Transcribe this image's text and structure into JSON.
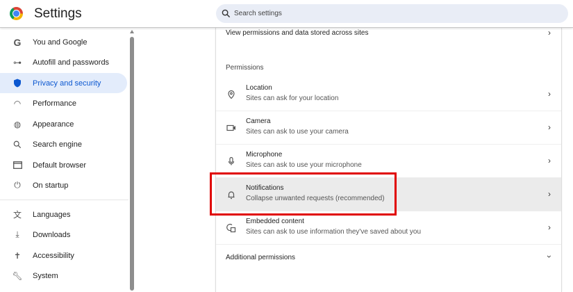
{
  "header": {
    "title": "Settings",
    "search_placeholder": "Search settings"
  },
  "sidebar": {
    "items": [
      {
        "label": "You and Google",
        "icon": "google-icon"
      },
      {
        "label": "Autofill and passwords",
        "icon": "key-icon"
      },
      {
        "label": "Privacy and security",
        "icon": "shield-icon",
        "selected": true
      },
      {
        "label": "Performance",
        "icon": "gauge-icon"
      },
      {
        "label": "Appearance",
        "icon": "palette-icon"
      },
      {
        "label": "Search engine",
        "icon": "search-icon"
      },
      {
        "label": "Default browser",
        "icon": "browser-icon"
      },
      {
        "label": "On startup",
        "icon": "power-icon"
      },
      {
        "label": "Languages",
        "icon": "translate-icon"
      },
      {
        "label": "Downloads",
        "icon": "download-icon"
      },
      {
        "label": "Accessibility",
        "icon": "accessibility-icon"
      },
      {
        "label": "System",
        "icon": "wrench-icon"
      }
    ]
  },
  "main": {
    "view_permissions": "View permissions and data stored across sites",
    "permissions_heading": "Permissions",
    "permissions": [
      {
        "title": "Location",
        "subtitle": "Sites can ask for your location",
        "icon": "location-pin-icon"
      },
      {
        "title": "Camera",
        "subtitle": "Sites can ask to use your camera",
        "icon": "camera-icon"
      },
      {
        "title": "Microphone",
        "subtitle": "Sites can ask to use your microphone",
        "icon": "microphone-icon"
      },
      {
        "title": "Notifications",
        "subtitle": "Collapse unwanted requests (recommended)",
        "icon": "bell-icon",
        "highlighted": true
      },
      {
        "title": "Embedded content",
        "subtitle": "Sites can ask to use information they've saved about you",
        "icon": "embedded-content-icon"
      }
    ],
    "additional_permissions": "Additional permissions"
  },
  "colors": {
    "accent": "#0b57d0",
    "selected_bg": "#e3ecfb",
    "highlight_box": "#e00000"
  }
}
